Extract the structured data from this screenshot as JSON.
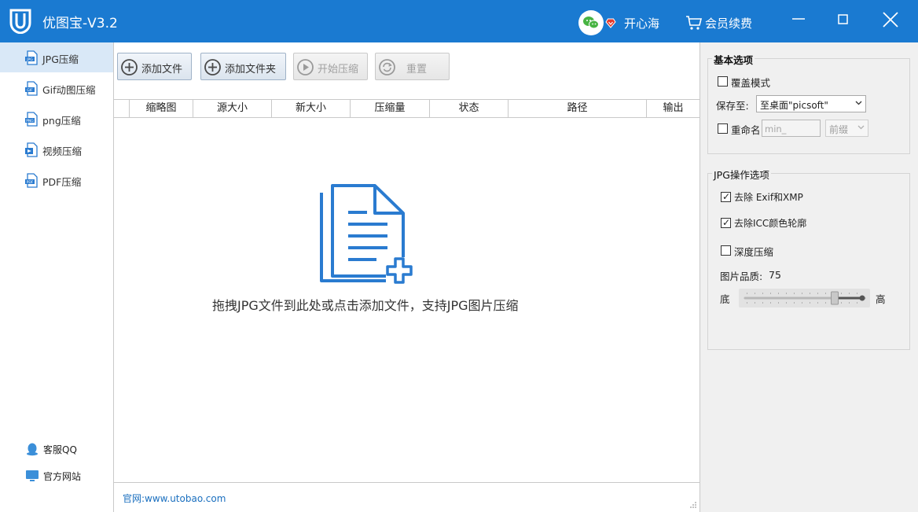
{
  "app": {
    "title": "优图宝-V3.2",
    "brand_color": "#1a7ad1",
    "logo_icon": "u-shield-logo"
  },
  "header": {
    "wechat_icon": "wechat-icon",
    "username": "开心海",
    "cart_icon": "cart-icon",
    "renew_label": "会员续费",
    "window_controls": [
      "minimize",
      "maximize",
      "close"
    ]
  },
  "sidebar": {
    "items": [
      {
        "label": "JPG压缩",
        "icon": "jpg-file-icon",
        "active": true
      },
      {
        "label": "Gif动图压缩",
        "icon": "gif-file-icon",
        "active": false
      },
      {
        "label": "png压缩",
        "icon": "png-file-icon",
        "active": false
      },
      {
        "label": "视频压缩",
        "icon": "video-file-icon",
        "active": false
      },
      {
        "label": "PDF压缩",
        "icon": "pdf-file-icon",
        "active": false
      }
    ],
    "bottom": [
      {
        "label": "客服QQ",
        "icon": "qq-penguin-icon"
      },
      {
        "label": "官方网站",
        "icon": "monitor-icon"
      }
    ]
  },
  "toolbar": {
    "add_file": "添加文件",
    "add_folder": "添加文件夹",
    "start": "开始压缩",
    "reset": "重置"
  },
  "table": {
    "columns": [
      "缩略图",
      "源大小",
      "新大小",
      "压缩量",
      "状态",
      "路径",
      "输出"
    ],
    "rows": []
  },
  "main": {
    "drop_icon": "document-add-icon",
    "drop_hint": "拖拽JPG文件到此处或点击添加文件，支持JPG图片压缩",
    "website": "官网:www.utobao.com"
  },
  "basic_options": {
    "title": "基本选项",
    "overwrite_label": "覆盖模式",
    "overwrite_checked": false,
    "save_to_label": "保存至:",
    "save_to_value": "至桌面\"picsoft\"",
    "rename_label": "重命名",
    "rename_checked": false,
    "rename_placeholder": "min_",
    "prefix_value": "前缀"
  },
  "jpg_options": {
    "title": "JPG操作选项",
    "remove_exif_label": "去除 Exif和XMP",
    "remove_exif_checked": true,
    "remove_icc_label": "去除ICC颜色轮廓",
    "remove_icc_checked": true,
    "deep_label": "深度压缩",
    "deep_checked": false,
    "quality_label": "图片品质:",
    "quality_value": "75",
    "low_label": "底",
    "high_label": "高",
    "slider_level": 0.75
  }
}
